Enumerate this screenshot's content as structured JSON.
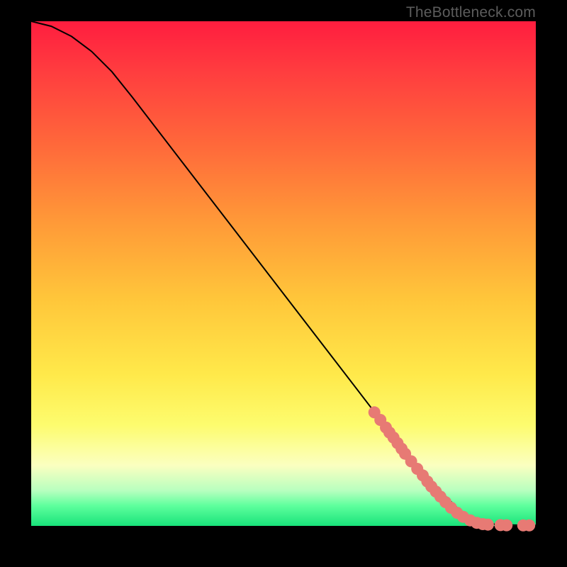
{
  "watermark": "TheBottleneck.com",
  "chart_data": {
    "type": "line",
    "title": "",
    "xlabel": "",
    "ylabel": "",
    "xlim": [
      0,
      100
    ],
    "ylim": [
      0,
      100
    ],
    "curve": {
      "x": [
        0,
        4,
        8,
        12,
        16,
        20,
        30,
        40,
        50,
        60,
        70,
        80,
        85,
        88,
        90,
        92,
        94,
        96,
        98,
        100
      ],
      "y": [
        100,
        99,
        97,
        94,
        90,
        85,
        72,
        59,
        46,
        33,
        20,
        8,
        3,
        1.3,
        0.6,
        0.3,
        0.2,
        0.15,
        0.1,
        0.1
      ]
    },
    "points": [
      {
        "x": 68.0,
        "y": 22.5
      },
      {
        "x": 69.2,
        "y": 21.0
      },
      {
        "x": 70.3,
        "y": 19.5
      },
      {
        "x": 71.0,
        "y": 18.5
      },
      {
        "x": 71.8,
        "y": 17.5
      },
      {
        "x": 72.6,
        "y": 16.4
      },
      {
        "x": 73.4,
        "y": 15.3
      },
      {
        "x": 74.1,
        "y": 14.3
      },
      {
        "x": 75.3,
        "y": 12.8
      },
      {
        "x": 76.5,
        "y": 11.3
      },
      {
        "x": 77.6,
        "y": 10.0
      },
      {
        "x": 78.5,
        "y": 8.8
      },
      {
        "x": 79.3,
        "y": 7.8
      },
      {
        "x": 80.2,
        "y": 6.8
      },
      {
        "x": 81.1,
        "y": 5.8
      },
      {
        "x": 82.1,
        "y": 4.7
      },
      {
        "x": 83.2,
        "y": 3.6
      },
      {
        "x": 84.4,
        "y": 2.6
      },
      {
        "x": 85.6,
        "y": 1.8
      },
      {
        "x": 87.0,
        "y": 1.1
      },
      {
        "x": 88.3,
        "y": 0.6
      },
      {
        "x": 89.5,
        "y": 0.35
      },
      {
        "x": 90.5,
        "y": 0.25
      },
      {
        "x": 93.0,
        "y": 0.15
      },
      {
        "x": 94.2,
        "y": 0.13
      },
      {
        "x": 97.5,
        "y": 0.1
      },
      {
        "x": 98.7,
        "y": 0.1
      }
    ],
    "point_color": "#e77a74",
    "point_radius": 8.5,
    "line_color": "#000000",
    "line_width": 2
  }
}
